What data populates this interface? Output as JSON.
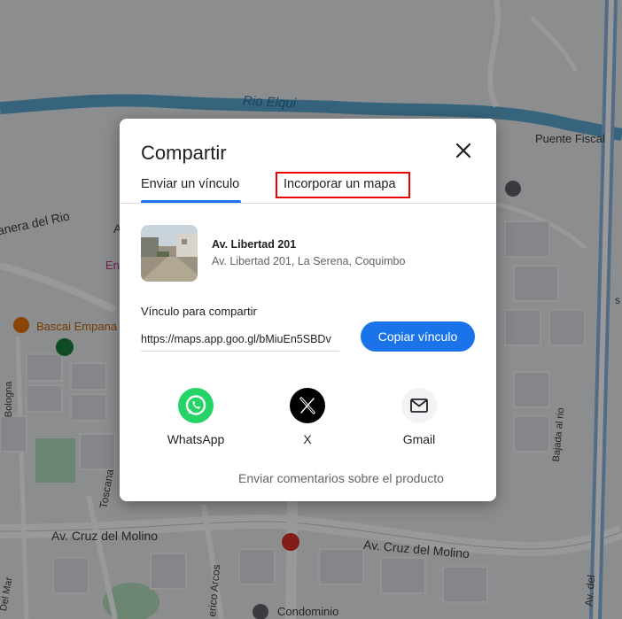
{
  "map": {
    "labels": {
      "rio_elqui": "Rio Elqui",
      "puente_fiscal": "Puente Fiscal",
      "ribera": "anera del Rio",
      "bascai": "Bascai Empana",
      "cruz_molino_left": "Av. Cruz del Molino",
      "cruz_molino_right": "Av. Cruz del Molino",
      "condominio": "Condominio",
      "bajada": "Bajada al rio",
      "toscana": "Toscana",
      "bologna": "Bologna",
      "del_mar": "Del Mar",
      "erico_arcos": "erico Arcos",
      "av_del": "Av. del",
      "frag_a": "A",
      "frag_en": "En",
      "frag_s": "s"
    }
  },
  "dialog": {
    "title": "Compartir",
    "tabs": [
      {
        "label": "Enviar un vínculo",
        "selected": true
      },
      {
        "label": "Incorporar un mapa",
        "selected": false
      }
    ],
    "place": {
      "name": "Av. Libertad 201",
      "address": "Av. Libertad 201, La Serena, Coquimbo"
    },
    "link_label": "Vínculo para compartir",
    "link_value": "https://maps.app.goo.gl/bMiuEn5SBDv",
    "copy_button": "Copiar vínculo",
    "share_options": [
      {
        "label": "WhatsApp",
        "icon": "whatsapp-icon",
        "color": "#25d366"
      },
      {
        "label": "X",
        "icon": "x-icon",
        "color": "#000000"
      },
      {
        "label": "Gmail",
        "icon": "mail-icon",
        "color": "#f1f3f4"
      }
    ],
    "feedback": "Enviar comentarios sobre el producto"
  },
  "colors": {
    "accent": "#1a73e8",
    "highlight_box": "#e00000",
    "river": "#5ba7cf"
  }
}
